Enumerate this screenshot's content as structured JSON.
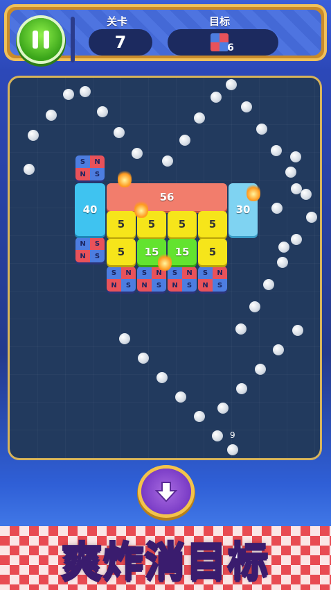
{
  "header": {
    "level_label": "关卡",
    "level_value": "7",
    "target_label": "目标",
    "target_count": "6",
    "target_icon": "magnet-block-icon"
  },
  "board": {
    "ball_count": "9",
    "blocks": {
      "cyan_left": "40",
      "orange_top": "56",
      "cyan_right": "30",
      "yellow_row1_a": "5",
      "yellow_row1_b": "5",
      "yellow_row1_c": "5",
      "yellow_row1_d": "5",
      "yellow_row2_a": "5",
      "green_a": "15",
      "green_b": "15",
      "yellow_row2_b": "5"
    },
    "magnet_letters": {
      "n": "N",
      "s": "S"
    }
  },
  "controls": {
    "drop_icon": "down-arrow-icon"
  },
  "banner": {
    "slogan": "爽炸消目标"
  },
  "colors": {
    "accent_gold": "#f0c15a",
    "board": "#223a5e",
    "magnet_red": "#e8525a",
    "magnet_blue": "#4d7de0"
  }
}
